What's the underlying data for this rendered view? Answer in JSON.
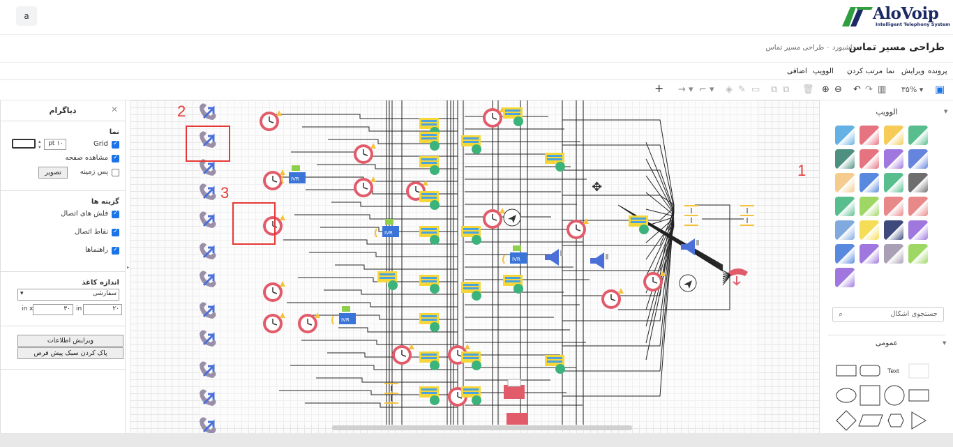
{
  "header": {
    "avatar_letter": "a",
    "logo_title": "AloVoip",
    "logo_sub": "Intelligent Telephony System"
  },
  "page": {
    "title": "طراحی مسیر تماس",
    "breadcrumb": [
      "داشبورد",
      "طراحی مسیر تماس"
    ],
    "breadcrumb_sep": "-"
  },
  "menu": {
    "file": "پرونده",
    "edit": "ویرایش",
    "view": "نما",
    "arrange": "مرتب کردن",
    "alovoip": "الوویپ",
    "extras": "اضافی"
  },
  "toolbar": {
    "zoom": "۳۵%"
  },
  "left_panel": {
    "title": "دیاگرام",
    "view_title": "نما",
    "grid_label": "Grid",
    "grid_size": "pt ۱۰",
    "page_view_label": "مشاهده صفحه",
    "background_label": "پس زمینه",
    "image_button": "تصویر",
    "options_title": "گزینه ها",
    "connection_arrows": "فلش های اتصال",
    "connection_points": "نقاط اتصال",
    "guides": "راهنماها",
    "paper_size_title": "اندازه کاغذ",
    "paper_size_value": "سفارشی",
    "width_value": "۲۰",
    "height_value": "۳۰",
    "unit_in": "in",
    "unit_in_x": "in x",
    "edit_data_button": "ویرایش اطلاعات",
    "clear_style_button": "پاک کردن سبک پیش فرض",
    "grid_checked": true,
    "page_view_checked": true,
    "background_checked": false
  },
  "right_panel": {
    "library_title": "الوویپ",
    "search_placeholder": "جستجوی اشکال",
    "general_title": "عمومی",
    "text_shape_label": "Text"
  },
  "annotations": {
    "callout_1": "1",
    "callout_2": "2",
    "callout_3": "3"
  },
  "colors": {
    "highlight": "#e53935",
    "brand_navy": "#1b2a64",
    "brand_green": "#2e9e3e",
    "accent_blue": "#1a73e8"
  }
}
